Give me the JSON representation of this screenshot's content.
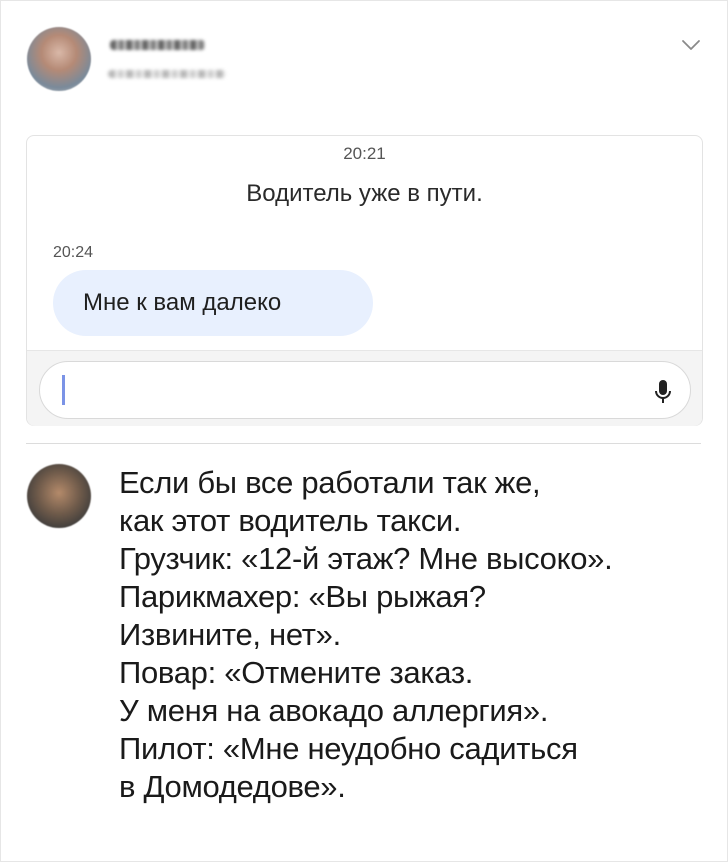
{
  "chat": {
    "time_top": "20:21",
    "system_message": "Водитель уже в пути.",
    "time_left": "20:24",
    "bubble_text": "Мне к вам далеко"
  },
  "icons": {
    "header_menu": "chevron-down-icon",
    "composer": "microphone-icon"
  },
  "comment": {
    "lines": [
      "Если бы все работали так же,",
      "как этот водитель такси.",
      "Грузчик: «12-й этаж? Мне высоко».",
      "Парикмахер: «Вы рыжая?",
      "Извините, нет».",
      "Повар: «Отмените заказ.",
      "У меня на авокадо аллергия».",
      "Пилот: «Мне неудобно садиться",
      "в Домодедове»."
    ]
  },
  "colors": {
    "bubble_bg": "#e8f0fe",
    "caret": "#7b93e6"
  }
}
